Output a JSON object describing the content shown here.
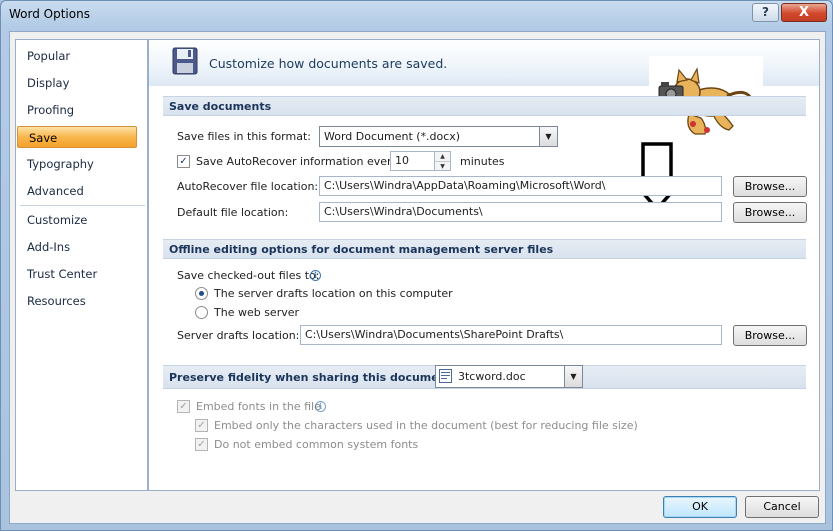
{
  "window": {
    "title": "Word Options",
    "help_label": "?",
    "close_label": "X"
  },
  "nav": {
    "items": [
      {
        "label": "Popular"
      },
      {
        "label": "Display"
      },
      {
        "label": "Proofing"
      },
      {
        "label": "Save"
      },
      {
        "label": "Typography"
      },
      {
        "label": "Advanced"
      },
      {
        "label": "Customize"
      },
      {
        "label": "Add-Ins"
      },
      {
        "label": "Trust Center"
      },
      {
        "label": "Resources"
      }
    ],
    "selected": "Save"
  },
  "banner": {
    "text": "Customize how documents are saved."
  },
  "save_documents": {
    "header": "Save documents",
    "format_label": "Save files in this format:",
    "format_value": "Word Document (*.docx)",
    "autorecover_label": "Save AutoRecover information every",
    "autorecover_minutes": "10",
    "minutes_label": "minutes",
    "autorecover_location_label": "AutoRecover file location:",
    "autorecover_location_value": "C:\\Users\\Windra\\AppData\\Roaming\\Microsoft\\Word\\",
    "default_location_label": "Default file location:",
    "default_location_value": "C:\\Users\\Windra\\Documents\\",
    "browse_label": "Browse..."
  },
  "offline": {
    "header": "Offline editing options for document management server files",
    "save_checked_out_label": "Save checked-out files to:",
    "radio_server": "The server drafts location on this computer",
    "radio_web": "The web server",
    "server_drafts_label": "Server drafts location:",
    "server_drafts_value": "C:\\Users\\Windra\\Documents\\SharePoint Drafts\\",
    "browse_label": "Browse..."
  },
  "fidelity": {
    "header": "Preserve fidelity when sharing this document:",
    "document_value": "3tcword.doc",
    "embed_fonts_label": "Embed fonts in the file",
    "embed_only_label": "Embed only the characters used in the document (best for reducing file size)",
    "no_common_label": "Do not embed common system fonts"
  },
  "footer": {
    "ok_label": "OK",
    "cancel_label": "Cancel"
  },
  "colors": {
    "selected_nav": "#f8b64c",
    "section_header_text": "#1b355a",
    "close_button": "#d2482d"
  }
}
